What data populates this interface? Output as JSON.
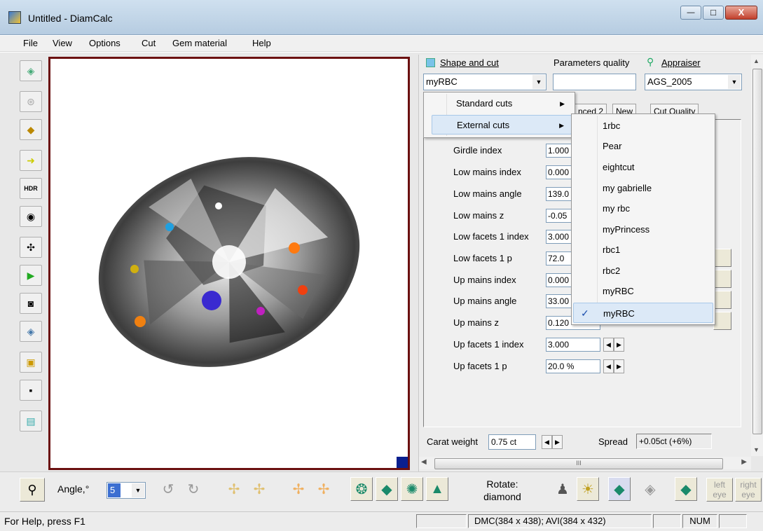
{
  "window": {
    "title": "Untitled - DiamCalc",
    "controls": {
      "minimize": "—",
      "maximize": "□",
      "close": "X"
    }
  },
  "menubar": [
    "File",
    "View",
    "Options",
    "Cut",
    "Gem material",
    "Help"
  ],
  "panel": {
    "shape_label": "Shape and cut",
    "shape_value": "myRBC",
    "params_label": "Parameters quality",
    "params_value": "",
    "appraiser_label": "Appraiser",
    "appraiser_value": "AGS_2005",
    "tabs": [
      "nced 2",
      "New",
      "Cut Quality"
    ],
    "params": [
      {
        "label": "Girdle index",
        "value": "1.000"
      },
      {
        "label": "Low mains index",
        "value": "0.000"
      },
      {
        "label": "Low mains angle",
        "value": "139.0"
      },
      {
        "label": "Low mains z",
        "value": "-0.05"
      },
      {
        "label": "Low facets 1 index",
        "value": "3.000"
      },
      {
        "label": "Low facets 1 p",
        "value": "72.0"
      },
      {
        "label": "Up mains index",
        "value": "0.000"
      },
      {
        "label": "Up mains angle",
        "value": "33.00"
      },
      {
        "label": "Up mains z",
        "value": "0.120"
      },
      {
        "label": "Up facets 1 index",
        "value": "3.000"
      },
      {
        "label": "Up facets 1 p",
        "value": "20.0 %"
      }
    ],
    "carat_label": "Carat weight",
    "carat_value": "0.75 ct",
    "spread_label": "Spread",
    "spread_value": "+0.05ct (+6%)",
    "hscroll_grip": "III"
  },
  "dropdown": {
    "items": [
      "Standard cuts",
      "External cuts"
    ],
    "submenu": [
      "1rbc",
      "Pear",
      "eightcut",
      "my gabrielle",
      "my rbc",
      "myPrincess",
      "rbc1",
      "rbc2",
      "myRBC",
      "myRBC"
    ],
    "checked_index": 9,
    "arrow": "▶",
    "check": "✓"
  },
  "left_toolbar": {
    "hdr_label": "HDR"
  },
  "bottom_toolbar": {
    "angle_label": "Angle,°",
    "angle_value": "5",
    "rotate_label_1": "Rotate:",
    "rotate_label_2": "diamond",
    "left_eye": [
      "left",
      "eye"
    ],
    "right_eye": [
      "right",
      "eye"
    ]
  },
  "statusbar": {
    "help": "For Help, press F1",
    "info": "DMC(384 x 438); AVI(384 x 432)",
    "num": "NUM"
  }
}
